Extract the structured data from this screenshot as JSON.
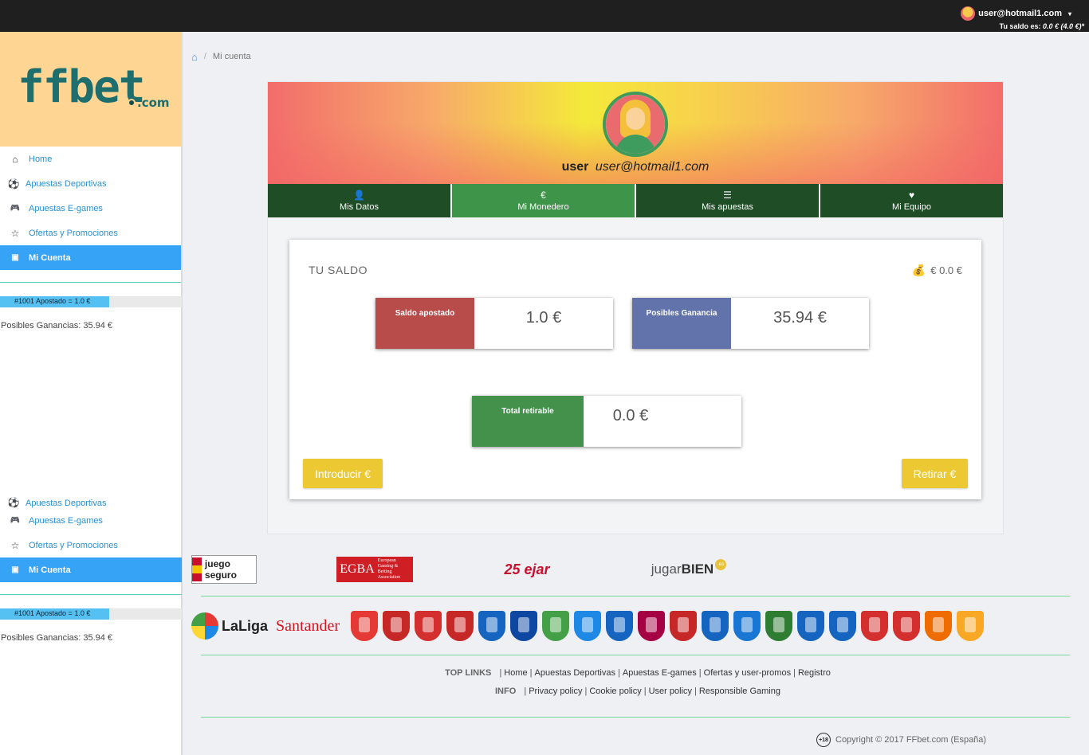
{
  "topbar": {
    "user_email": "user@hotmail1.com",
    "caret": "▾",
    "balance_label": "Tu saldo es:",
    "balance_value": "0.0 € (4.0 €)*"
  },
  "logo": {
    "main": "ffbet",
    "suffix": ".com"
  },
  "sidebar": {
    "items": [
      {
        "label": "Home",
        "icon": "home-icon",
        "glyph": "⌂"
      },
      {
        "label": "Apuestas Deportivas",
        "icon": "soccer-ball-icon",
        "glyph": "⚽"
      },
      {
        "label": "Apuestas E-games",
        "icon": "gamepad-icon",
        "glyph": "🎮"
      },
      {
        "label": "Ofertas y Promociones",
        "icon": "star-icon",
        "glyph": "☆"
      },
      {
        "label": "Mi Cuenta",
        "icon": "id-card-icon",
        "glyph": "▣"
      }
    ],
    "bet_progress": {
      "label": "#1001 Apostado = 1.0 €",
      "fill_fraction": 0.6
    },
    "posibles": "Posibles Ganancias: 35.94 €"
  },
  "breadcrumb": {
    "home_glyph": "⌂",
    "separator": "/",
    "current": "Mi cuenta"
  },
  "profile": {
    "username": "user",
    "email": "user@hotmail1.com",
    "tabs": [
      {
        "label": "Mis Datos",
        "glyph": "👤"
      },
      {
        "label": "Mi Monedero",
        "glyph": "€"
      },
      {
        "label": "Mis apuestas",
        "glyph": "☰"
      },
      {
        "label": "Mi Equipo",
        "glyph": "♥"
      }
    ]
  },
  "wallet": {
    "title": "TU SALDO",
    "balance_glyph": "💰",
    "balance": "€ 0.0 €",
    "saldo_apostado_label": "Saldo apostado",
    "saldo_apostado_value": "1.0 €",
    "posibles_label": "Posibles Ganancia",
    "posibles_value": "35.94 €",
    "total_label": "Total retirable",
    "total_value": "0.0 €",
    "deposit_button": "Introducir €",
    "withdraw_button": "Retirar €"
  },
  "partners": {
    "juego_seguro": "juego seguro",
    "egba": "EGBA",
    "egba_sub": "European Gaming & Betting Association",
    "ejar": "25 ejar",
    "jugarbien_a": "jugar",
    "jugarbien_b": "BIEN",
    "jugarbien_badge": ".es"
  },
  "laliga": {
    "laliga_text": "LaLiga",
    "santander_text": "Santander",
    "crest_colors": [
      "#e53935",
      "#c62828",
      "#d32f2f",
      "#c62828",
      "#1565c0",
      "#0d47a1",
      "#43a047",
      "#1e88e5",
      "#1565c0",
      "#a50044",
      "#c62828",
      "#1565c0",
      "#1976d2",
      "#2e7d32",
      "#1565c0",
      "#1565c0",
      "#d32f2f",
      "#d32f2f",
      "#ef6c00",
      "#f9a825"
    ]
  },
  "footer": {
    "top_links_label": "TOP LINKS",
    "top_links": [
      "Home",
      "Apuestas Deportivas",
      "Apuestas E-games",
      "Ofertas y user-promos",
      "Registro"
    ],
    "info_label": "INFO",
    "info_links": [
      "Privacy policy",
      "Cookie policy",
      "User policy",
      "Responsible Gaming"
    ],
    "age_badge": "+18",
    "copyright": "Copyright © 2017 FFbet.com (España)"
  }
}
